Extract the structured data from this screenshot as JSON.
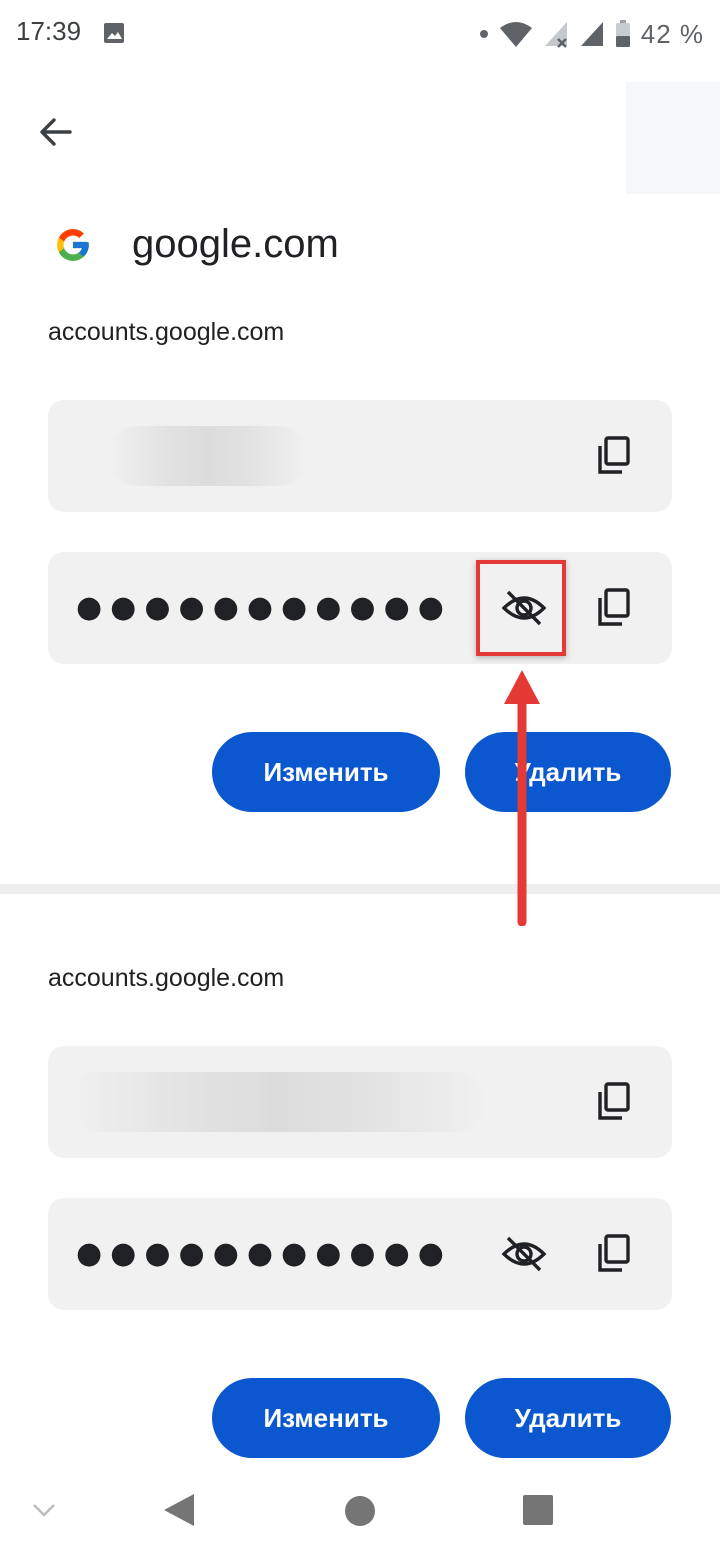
{
  "status": {
    "time": "17:39",
    "battery_percent": "42 %"
  },
  "header": {
    "site_title": "google.com",
    "logo": "google-g-logo"
  },
  "entries": [
    {
      "domain": "accounts.google.com",
      "username_hidden": true,
      "password_mask": "●●●●●●●●●●●",
      "edit_label": "Изменить",
      "delete_label": "Удалить"
    },
    {
      "domain": "accounts.google.com",
      "username_hidden": true,
      "password_mask": "●●●●●●●●●●●",
      "edit_label": "Изменить",
      "delete_label": "Удалить"
    }
  ],
  "icons": {
    "back": "arrow-back-icon",
    "copy": "copy-icon",
    "visibility": "visibility-off-icon"
  },
  "colors": {
    "primary_button": "#0b57d0",
    "field_background": "#f1f1f1",
    "annotation": "#e53935"
  }
}
